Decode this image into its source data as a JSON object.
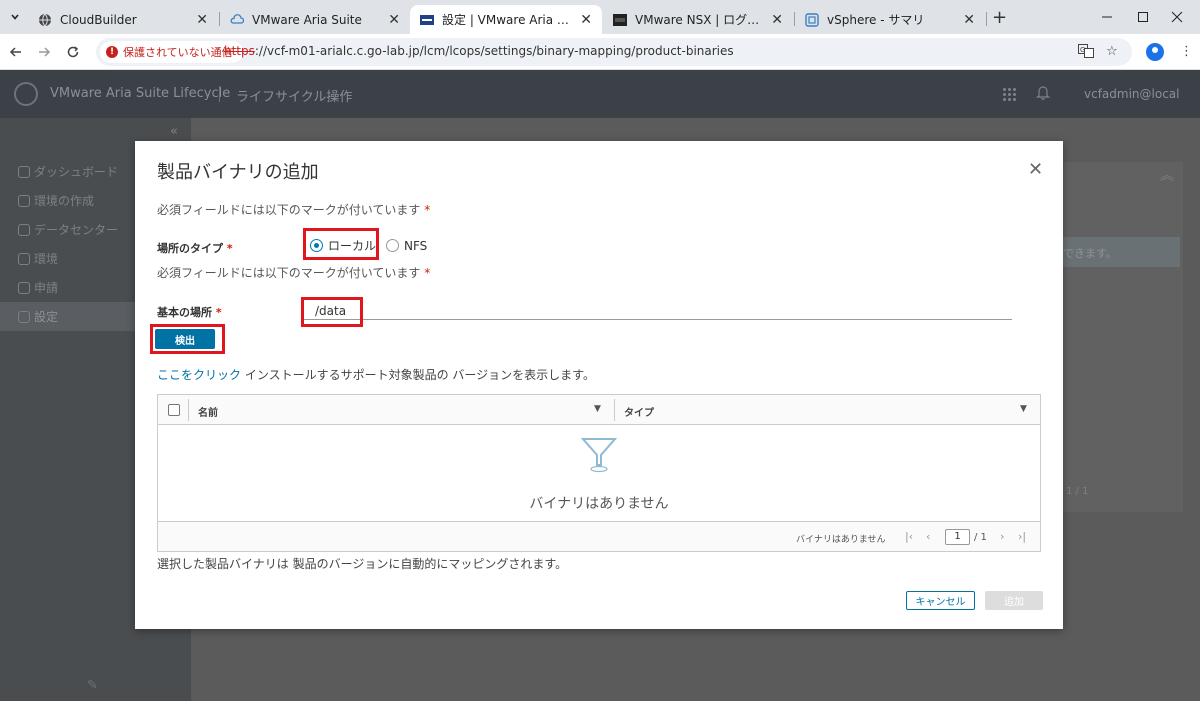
{
  "browser": {
    "tabs": [
      {
        "title": "CloudBuilder",
        "favicon": "globe-icon",
        "active": false
      },
      {
        "title": "VMware Aria Suite",
        "favicon": "cloud-icon",
        "active": false
      },
      {
        "title": "設定 | VMware Aria Suite Lifecycle",
        "favicon": "vmware-icon",
        "active": true
      },
      {
        "title": "VMware NSX | ログイン",
        "favicon": "nsx-icon",
        "active": false
      },
      {
        "title": "vSphere - サマリ",
        "favicon": "vsphere-icon",
        "active": false
      }
    ],
    "new_tab": "+",
    "security_label": "保護されていない通信",
    "url_scheme": "https",
    "url_rest": "://vcf-m01-arialc.c.go-lab.jp/lcm/lcops/settings/binary-mapping/product-binaries"
  },
  "app": {
    "title": "VMware Aria Suite Lifecycle",
    "section": "ライフサイクル操作",
    "user": "vcfadmin@local",
    "sidebar": [
      {
        "label": "ダッシュボード"
      },
      {
        "label": "環境の作成"
      },
      {
        "label": "データセンター"
      },
      {
        "label": "環境"
      },
      {
        "label": "申請"
      },
      {
        "label": "設定"
      }
    ],
    "background_info": "できます。",
    "background_pager": "1 / 1"
  },
  "modal": {
    "title": "製品バイナリの追加",
    "required_note": "必須フィールドには以下のマークが付いています",
    "required_mark": "*",
    "location_type_label": "場所のタイプ",
    "radio_local": "ローカル",
    "radio_nfs": "NFS",
    "location_type_value": "ローカル",
    "base_location_label": "基本の場所",
    "base_location_value": "/data",
    "detect_button": "検出",
    "hint_link": "ここをクリック",
    "hint_text": " インストールするサポート対象製品の バージョンを表示します。",
    "grid": {
      "col_name": "名前",
      "col_type": "タイプ",
      "empty_text": "バイナリはありません",
      "footer_text": "バイナリはありません",
      "page_current": "1",
      "page_total": "/ 1"
    },
    "footnote": "選択した製品バイナリは 製品のバージョンに自動的にマッピングされます。",
    "cancel_button": "キャンセル",
    "add_button": "追加"
  },
  "colors": {
    "primary": "#0072a3",
    "highlight": "#e0161e",
    "required": "#c92100"
  }
}
